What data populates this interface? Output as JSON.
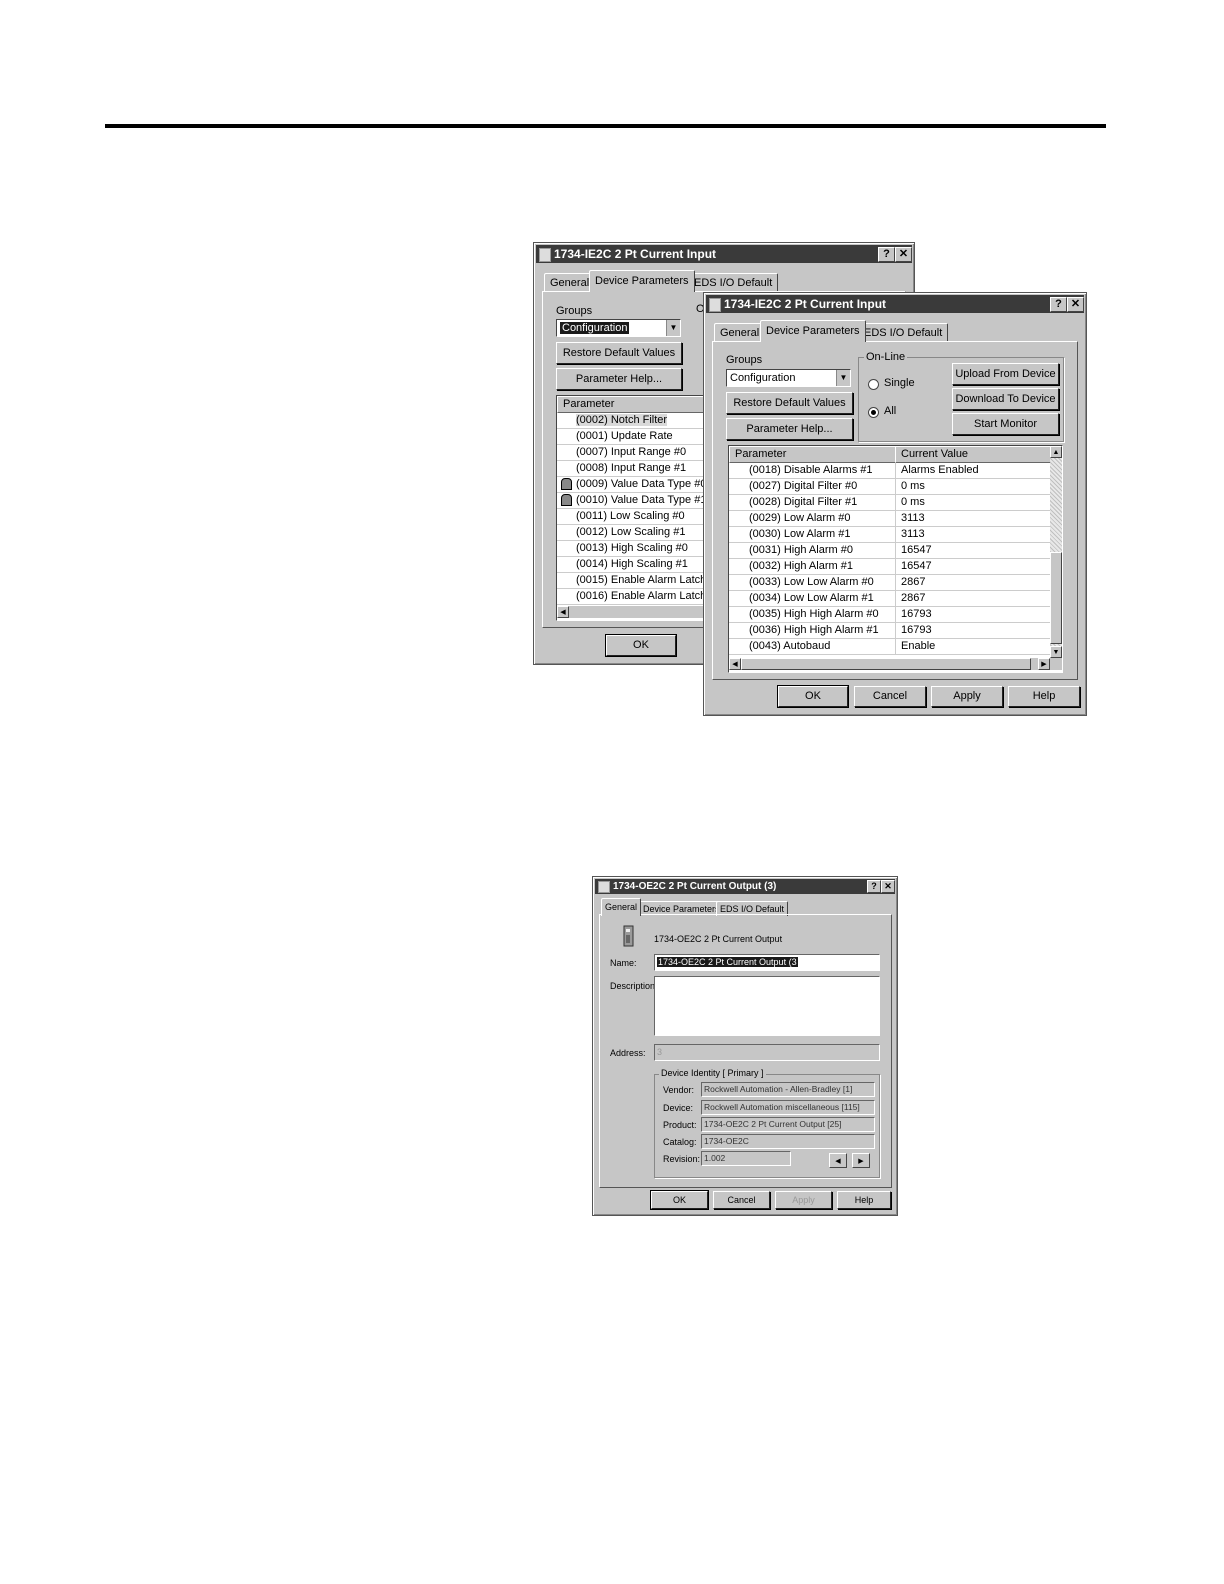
{
  "dialog_back": {
    "title": "1734-IE2C 2 Pt Current Input",
    "tabs": [
      "General",
      "Device Parameters",
      "EDS I/O Default"
    ],
    "groups_label": "Groups",
    "groups_value": "Configuration",
    "restore_label": "Restore Default Values",
    "param_help_label": "Parameter Help...",
    "online_fragment": "O",
    "col_parameter": "Parameter",
    "rows": [
      {
        "text": "(0002) Notch Filter",
        "locked": false
      },
      {
        "text": "(0001) Update Rate",
        "locked": false
      },
      {
        "text": "(0007) Input Range #0",
        "locked": false
      },
      {
        "text": "(0008) Input Range #1",
        "locked": false
      },
      {
        "text": "(0009) Value Data Type #0",
        "locked": true
      },
      {
        "text": "(0010) Value Data Type #1",
        "locked": true
      },
      {
        "text": "(0011) Low Scaling #0",
        "locked": false
      },
      {
        "text": "(0012) Low Scaling #1",
        "locked": false
      },
      {
        "text": "(0013) High Scaling #0",
        "locked": false
      },
      {
        "text": "(0014) High Scaling #1",
        "locked": false
      },
      {
        "text": "(0015) Enable Alarm Latch #",
        "locked": false
      },
      {
        "text": "(0016) Enable Alarm Latch #",
        "locked": false
      }
    ],
    "ok_label": "OK"
  },
  "dialog_front": {
    "title": "1734-IE2C 2 Pt Current Input",
    "tabs": [
      "General",
      "Device Parameters",
      "EDS I/O Default"
    ],
    "groups_label": "Groups",
    "groups_value": "Configuration",
    "restore_label": "Restore Default Values",
    "param_help_label": "Parameter Help...",
    "online_label": "On-Line",
    "single_label": "Single",
    "all_label": "All",
    "upload_label": "Upload From Device",
    "download_label": "Download To Device",
    "start_monitor_label": "Start Monitor",
    "col_parameter": "Parameter",
    "col_value": "Current Value",
    "rows": [
      {
        "param": "(0018) Disable Alarms #1",
        "value": "Alarms Enabled"
      },
      {
        "param": "(0027) Digital Filter #0",
        "value": "0 ms"
      },
      {
        "param": "(0028) Digital Filter #1",
        "value": "0 ms"
      },
      {
        "param": "(0029) Low Alarm #0",
        "value": "3113"
      },
      {
        "param": "(0030) Low Alarm #1",
        "value": "3113"
      },
      {
        "param": "(0031) High Alarm #0",
        "value": "16547"
      },
      {
        "param": "(0032) High Alarm #1",
        "value": "16547"
      },
      {
        "param": "(0033) Low Low Alarm #0",
        "value": "2867"
      },
      {
        "param": "(0034) Low Low Alarm #1",
        "value": "2867"
      },
      {
        "param": "(0035) High High Alarm #0",
        "value": "16793"
      },
      {
        "param": "(0036) High High Alarm #1",
        "value": "16793"
      },
      {
        "param": "(0043) Autobaud",
        "value": "Enable"
      }
    ],
    "ok_label": "OK",
    "cancel_label": "Cancel",
    "apply_label": "Apply",
    "help_label": "Help"
  },
  "dialog_output": {
    "title": "1734-OE2C 2 Pt Current Output (3)",
    "tabs": [
      "General",
      "Device Parameters",
      "EDS I/O Default"
    ],
    "device_caption": "1734-OE2C 2 Pt Current Output",
    "name_label": "Name:",
    "name_value": "1734-OE2C 2 Pt Current Output (3",
    "description_label": "Description:",
    "description_value": "",
    "address_label": "Address:",
    "address_value": "3",
    "identity_label": "Device Identity [ Primary ]",
    "vendor_label": "Vendor:",
    "vendor_value": "Rockwell Automation - Allen-Bradley [1]",
    "device_label": "Device:",
    "device_value": "Rockwell Automation miscellaneous [115]",
    "product_label": "Product:",
    "product_value": "1734-OE2C 2 Pt Current Output [25]",
    "catalog_label": "Catalog:",
    "catalog_value": "1734-OE2C",
    "revision_label": "Revision:",
    "revision_value": "1.002",
    "ok_label": "OK",
    "cancel_label": "Cancel",
    "apply_label": "Apply",
    "help_label": "Help"
  }
}
